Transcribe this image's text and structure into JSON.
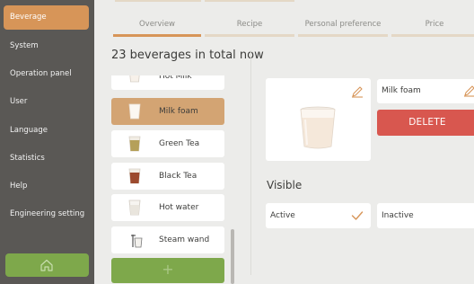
{
  "sidebar": {
    "items": [
      {
        "label": "Beverage",
        "active": true
      },
      {
        "label": "System"
      },
      {
        "label": "Operation panel"
      },
      {
        "label": "User"
      },
      {
        "label": "Language"
      },
      {
        "label": "Statistics"
      },
      {
        "label": "Help"
      },
      {
        "label": "Engineering setting"
      }
    ],
    "home_icon": "home-icon"
  },
  "tabs": [
    {
      "label": "Overview",
      "active": true
    },
    {
      "label": "Recipe"
    },
    {
      "label": "Personal preference"
    },
    {
      "label": "Price"
    }
  ],
  "beverages": {
    "count_text": "23 beverages in total now",
    "items": [
      {
        "label": "Hot Milk",
        "icon": "milk-cup-icon"
      },
      {
        "label": "Milk foam",
        "icon": "milk-foam-cup-icon",
        "selected": true
      },
      {
        "label": "Green Tea",
        "icon": "green-tea-cup-icon"
      },
      {
        "label": "Black Tea",
        "icon": "black-tea-cup-icon"
      },
      {
        "label": "Hot water",
        "icon": "hot-water-cup-icon"
      },
      {
        "label": "Steam wand",
        "icon": "steam-wand-icon"
      }
    ],
    "add_label": "+"
  },
  "detail": {
    "name_value": "Milk foam",
    "delete_label": "DELETE",
    "visible_label": "Visible",
    "options": [
      {
        "label": "Active",
        "checked": true
      },
      {
        "label": "Inactive",
        "checked": false
      }
    ]
  },
  "colors": {
    "accent": "#d79558",
    "green": "#7ea84b",
    "danger": "#d8574f",
    "sidebar": "#5a5855"
  }
}
